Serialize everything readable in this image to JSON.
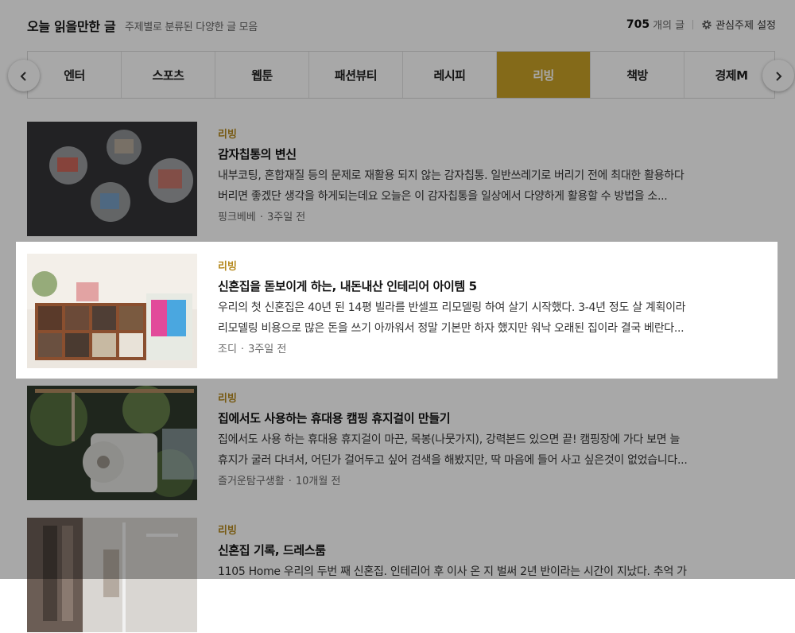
{
  "header": {
    "title": "오늘 읽을만한 글",
    "subtitle": "주제별로 분류된 다양한 글 모음",
    "count": "705",
    "count_suffix": "개의 글",
    "setting_label": "관심주제 설정",
    "setting_icon": "gear-icon"
  },
  "tabs": {
    "items": [
      {
        "label": "엔터"
      },
      {
        "label": "스포츠"
      },
      {
        "label": "웹툰"
      },
      {
        "label": "패션뷰티"
      },
      {
        "label": "레시피"
      },
      {
        "label": "리빙"
      },
      {
        "label": "책방"
      },
      {
        "label": "경제M"
      }
    ],
    "active_label": "리빙",
    "prev_icon": "chevron-left-icon",
    "next_icon": "chevron-right-icon",
    "active_color": "#c9a227"
  },
  "articles": [
    {
      "category": "리빙",
      "title": "감자칩통의 변신",
      "desc1": "내부코팅, 혼합재질 등의 문제로 재활용 되지 않는 감자칩통. 일반쓰레기로 버리기 전에 최대한 활용하다",
      "desc2": "버리면 좋겠단 생각을 하게되는데요 오늘은 이 감자칩통을 일상에서 다양하게 활용할 수 방법을 소...",
      "author": "핑크베베",
      "time": "3주일 전",
      "highlighted": false
    },
    {
      "category": "리빙",
      "title": "신혼집을 돋보이게 하는, 내돈내산 인테리어 아이템 5",
      "desc1": "우리의 첫 신혼집은 40년 된 14평 빌라를 반셀프 리모델링 하여 살기 시작했다. 3-4년 정도 살 계획이라",
      "desc2": "리모델링 비용으로 많은 돈을 쓰기 아까워서 정말 기본만 하자 했지만 워낙 오래된 집이라 결국 베란다...",
      "author": "조디",
      "time": "3주일 전",
      "highlighted": true
    },
    {
      "category": "리빙",
      "title": "집에서도 사용하는 휴대용 캠핑 휴지걸이 만들기",
      "desc1": "집에서도 사용 하는 휴대용 휴지걸이 마끈, 목봉(나뭇가지), 강력본드 있으면 끝! 캠핑장에 가다 보면 늘",
      "desc2": "휴지가 굴러 다녀서, 어딘가 걸어두고 싶어 검색을 해봤지만, 딱 마음에 들어 사고 싶은것이 없었습니다...",
      "author": "즐거운탐구생활",
      "time": "10개월 전",
      "highlighted": false
    },
    {
      "category": "리빙",
      "title": "신혼집 기록, 드레스룸",
      "desc1": "1105 Home 우리의 두번 째 신혼집. 인테리어 후 이사 온 지 벌써 2년 반이라는 시간이 지났다. 추억 가",
      "desc2": "",
      "author": "",
      "time": "",
      "highlighted": false
    }
  ],
  "colors": {
    "accent": "#c9a227",
    "category_text": "#b5891d",
    "dim_overlay": "rgba(0,0,0,0.34)"
  }
}
